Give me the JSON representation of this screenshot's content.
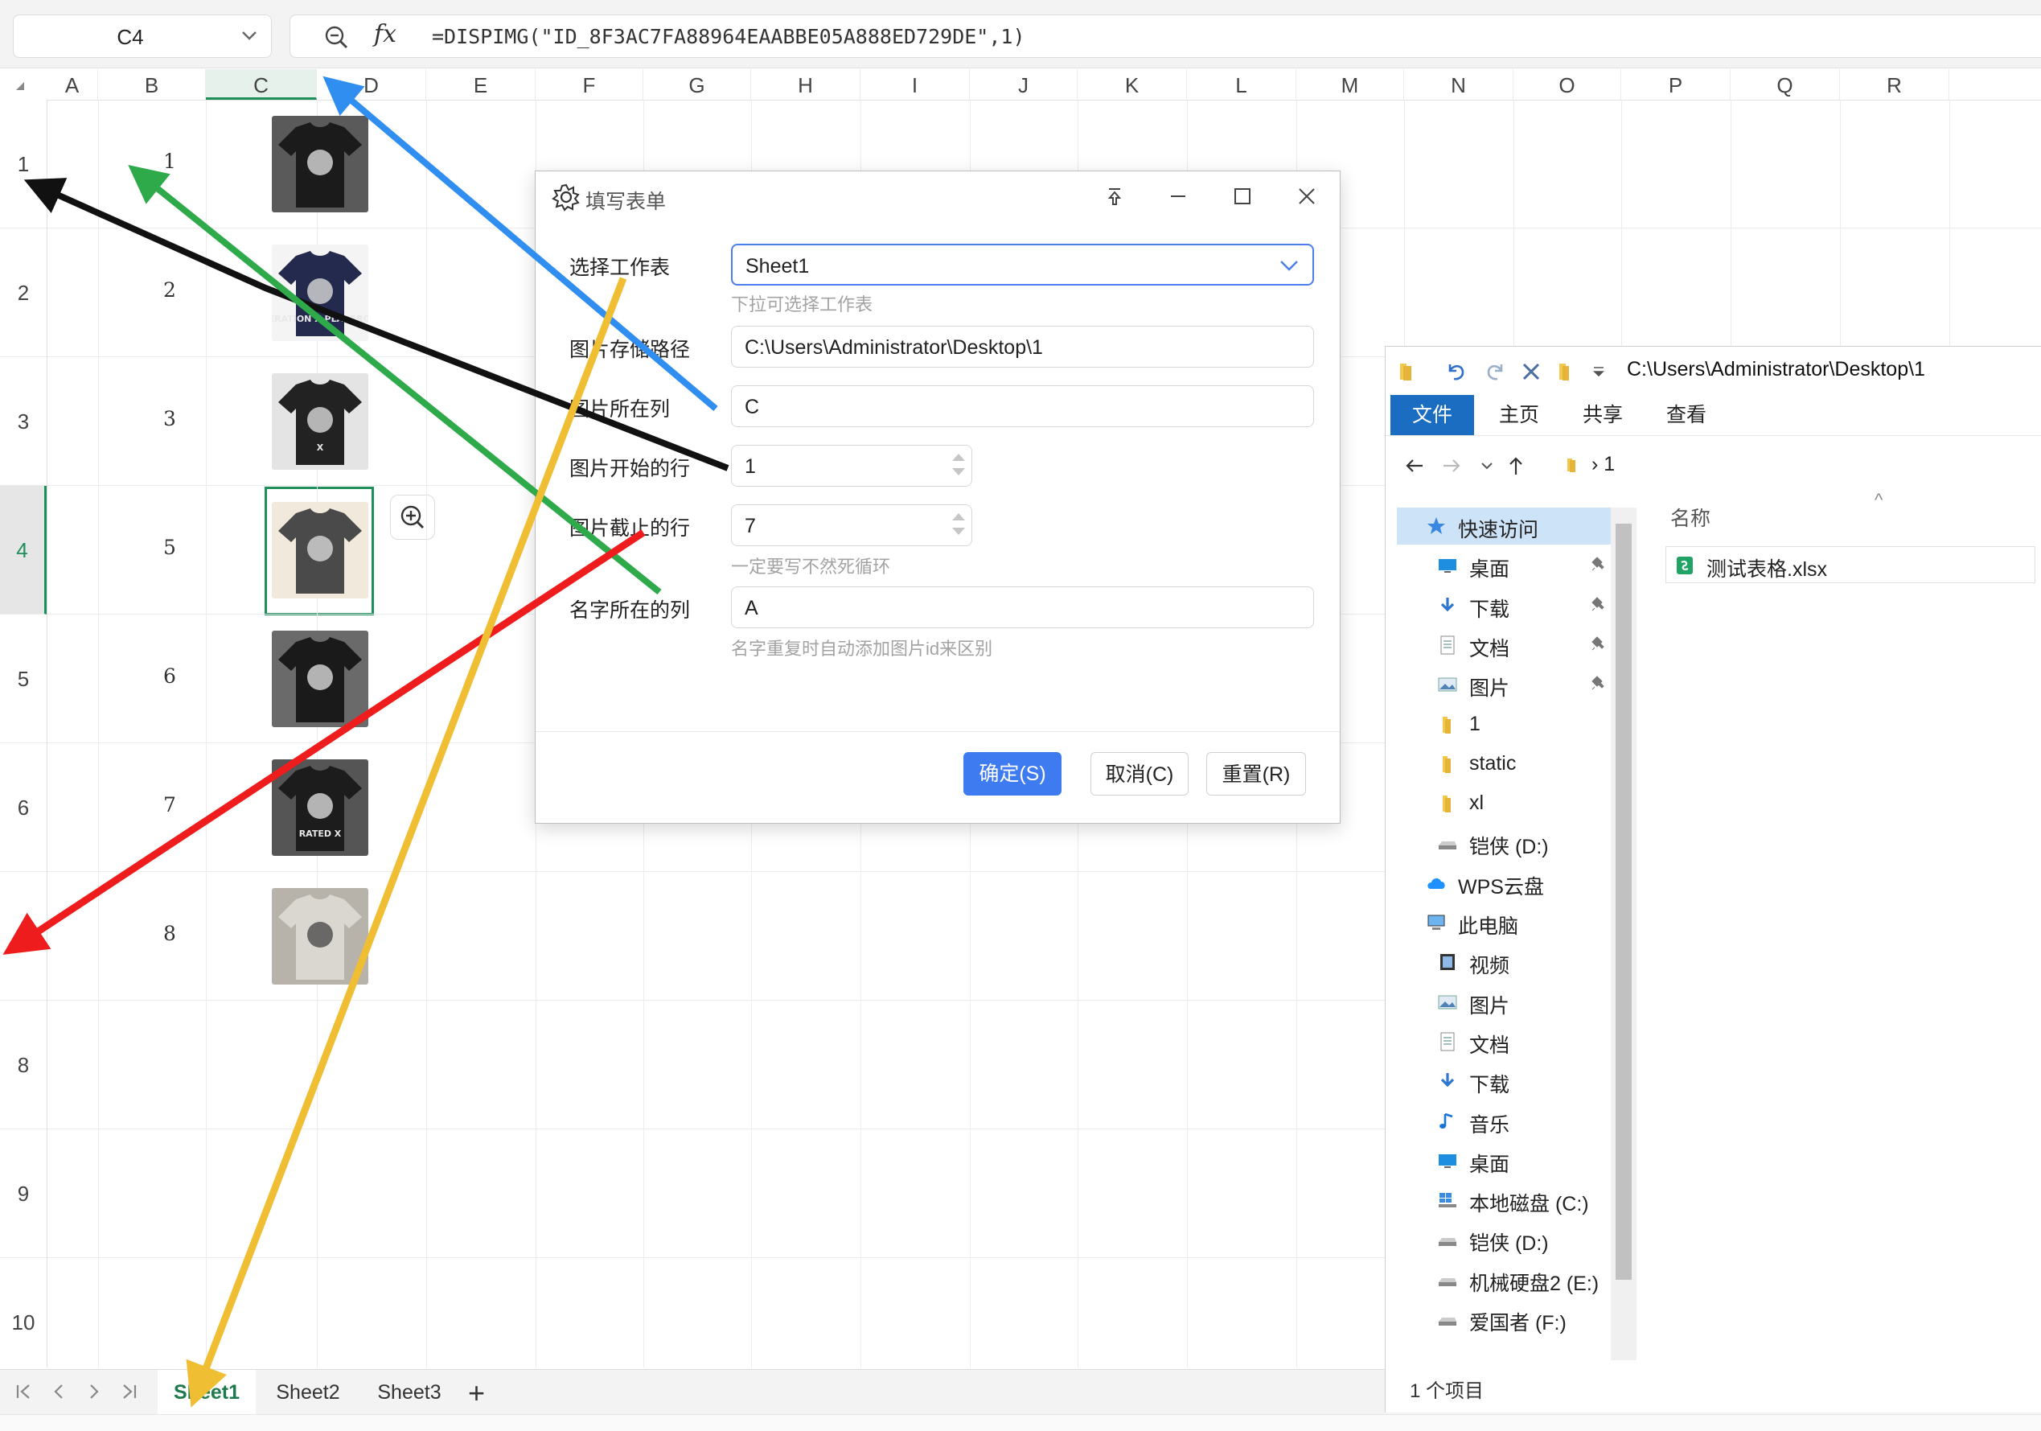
{
  "formula_bar": {
    "name_box": "C4",
    "fx_label": "fx",
    "formula": "=DISPIMG(\"ID_8F3AC7FA88964EAABBE05A888ED729DE\",1)"
  },
  "columns": [
    "A",
    "B",
    "C",
    "D",
    "E",
    "F",
    "G",
    "H",
    "I",
    "J",
    "K",
    "L",
    "M",
    "N",
    "O",
    "P",
    "Q",
    "R"
  ],
  "selected_column": "C",
  "rows": [
    "1",
    "2",
    "3",
    "4",
    "5",
    "6",
    "7",
    "8",
    "9",
    "10"
  ],
  "selected_row": "4",
  "column_b_values": [
    "1",
    "2",
    "3",
    "5",
    "6",
    "7",
    "8"
  ],
  "thumbnails": [
    {
      "name": "shirt-photo-1",
      "text": ""
    },
    {
      "name": "shirt-photo-2",
      "text": "GENERATION X PLAYGROUND"
    },
    {
      "name": "shirt-photo-3",
      "text": "X"
    },
    {
      "name": "shirt-photo-4",
      "text": ""
    },
    {
      "name": "shirt-photo-5",
      "text": ""
    },
    {
      "name": "shirt-photo-6",
      "text": "RATED X"
    },
    {
      "name": "shirt-photo-7",
      "text": ""
    }
  ],
  "sheet_tabs": [
    "Sheet1",
    "Sheet2",
    "Sheet3"
  ],
  "active_sheet": "Sheet1",
  "add_sheet_label": "+",
  "dialog": {
    "title": "填写表单",
    "fields": [
      {
        "label": "选择工作表",
        "value": "Sheet1",
        "hint": "下拉可选择工作表",
        "kind": "select"
      },
      {
        "label": "图片存储路径",
        "value": "C:\\Users\\Administrator\\Desktop\\1",
        "hint": "",
        "kind": "text"
      },
      {
        "label": "图片所在列",
        "value": "C",
        "hint": "",
        "kind": "text"
      },
      {
        "label": "图片开始的行",
        "value": "1",
        "hint": "",
        "kind": "number"
      },
      {
        "label": "图片截止的行",
        "value": "7",
        "hint": "一定要写不然死循环",
        "kind": "number"
      },
      {
        "label": "名字所在的列",
        "value": "A",
        "hint": "名字重复时自动添加图片id来区别",
        "kind": "text"
      }
    ],
    "buttons": {
      "confirm": "确定(S)",
      "cancel": "取消(C)",
      "reset": "重置(R)"
    }
  },
  "explorer": {
    "title_path": "C:\\Users\\Administrator\\Desktop\\1",
    "ribbon_tabs": [
      "文件",
      "主页",
      "共享",
      "查看"
    ],
    "address": "1",
    "address_sep": "›",
    "column_header": "名称",
    "nav_items": [
      {
        "label": "快速访问",
        "icon": "star-icon",
        "pinned": false,
        "highlight": true,
        "indent": 0
      },
      {
        "label": "桌面",
        "icon": "desktop-icon",
        "pinned": true,
        "highlight": false,
        "indent": 1
      },
      {
        "label": "下载",
        "icon": "download-icon",
        "pinned": true,
        "highlight": false,
        "indent": 1
      },
      {
        "label": "文档",
        "icon": "document-icon",
        "pinned": true,
        "highlight": false,
        "indent": 1
      },
      {
        "label": "图片",
        "icon": "picture-icon",
        "pinned": true,
        "highlight": false,
        "indent": 1
      },
      {
        "label": "1",
        "icon": "folder-icon",
        "pinned": false,
        "highlight": false,
        "indent": 1
      },
      {
        "label": "static",
        "icon": "folder-icon",
        "pinned": false,
        "highlight": false,
        "indent": 1
      },
      {
        "label": "xl",
        "icon": "folder-icon",
        "pinned": false,
        "highlight": false,
        "indent": 1
      },
      {
        "label": "铠侠 (D:)",
        "icon": "drive-icon",
        "pinned": false,
        "highlight": false,
        "indent": 1
      },
      {
        "label": "WPS云盘",
        "icon": "cloud-icon",
        "pinned": false,
        "highlight": false,
        "indent": 0
      },
      {
        "label": "此电脑",
        "icon": "computer-icon",
        "pinned": false,
        "highlight": false,
        "indent": 0
      },
      {
        "label": "视频",
        "icon": "video-icon",
        "pinned": false,
        "highlight": false,
        "indent": 1
      },
      {
        "label": "图片",
        "icon": "picture-icon",
        "pinned": false,
        "highlight": false,
        "indent": 1
      },
      {
        "label": "文档",
        "icon": "document-icon",
        "pinned": false,
        "highlight": false,
        "indent": 1
      },
      {
        "label": "下载",
        "icon": "download-icon",
        "pinned": false,
        "highlight": false,
        "indent": 1
      },
      {
        "label": "音乐",
        "icon": "music-icon",
        "pinned": false,
        "highlight": false,
        "indent": 1
      },
      {
        "label": "桌面",
        "icon": "desktop-icon",
        "pinned": false,
        "highlight": false,
        "indent": 1
      },
      {
        "label": "本地磁盘 (C:)",
        "icon": "windows-drive-icon",
        "pinned": false,
        "highlight": false,
        "indent": 1
      },
      {
        "label": "铠侠 (D:)",
        "icon": "drive-icon",
        "pinned": false,
        "highlight": false,
        "indent": 1
      },
      {
        "label": "机械硬盘2 (E:)",
        "icon": "drive-icon",
        "pinned": false,
        "highlight": false,
        "indent": 1
      },
      {
        "label": "爱国者 (F:)",
        "icon": "drive-icon",
        "pinned": false,
        "highlight": false,
        "indent": 1
      }
    ],
    "file": {
      "name": "测试表格.xlsx",
      "icon": "spreadsheet-file-icon"
    },
    "status": "1 个项目"
  },
  "colors": {
    "accent_green": "#1e8e5a",
    "dialog_primary": "#3e7bf1",
    "explorer_blue": "#1b6dc1",
    "arrow_black": "#111111",
    "arrow_green": "#2eaa4a",
    "arrow_blue": "#2f8ef0",
    "arrow_red": "#ee1c1c",
    "arrow_yellow": "#f0be33"
  }
}
